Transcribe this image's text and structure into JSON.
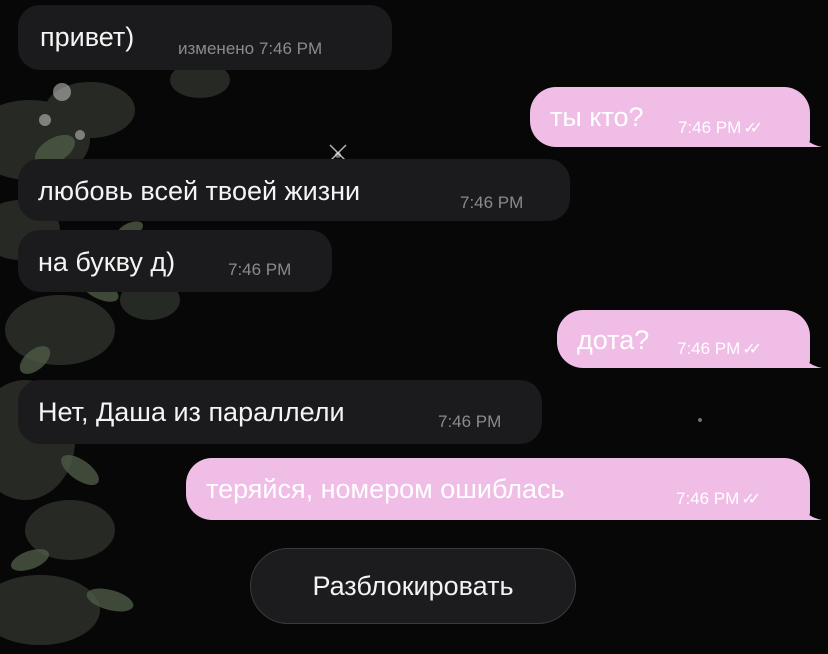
{
  "messages": [
    {
      "direction": "in",
      "text": "привет)",
      "status": "изменено",
      "time": "7:46 PM"
    },
    {
      "direction": "out",
      "text": "ты кто?",
      "time": "7:46 PM",
      "read": true
    },
    {
      "direction": "in",
      "text": "любовь всей твоей жизни",
      "time": "7:46 PM"
    },
    {
      "direction": "in",
      "text": "на букву д)",
      "time": "7:46 PM"
    },
    {
      "direction": "out",
      "text": "дота?",
      "time": "7:46 PM",
      "read": true
    },
    {
      "direction": "in",
      "text": "Нет, Даша из параллели",
      "time": "7:46 PM"
    },
    {
      "direction": "out",
      "text": "теряйся, номером ошиблась",
      "time": "7:46 PM",
      "read": true
    }
  ],
  "unblock_button": {
    "label": "Разблокировать"
  },
  "icons": {
    "read_receipt": "double-check-icon"
  },
  "colors": {
    "background": "#070707",
    "incoming_bubble": "#1b1b1d",
    "outgoing_bubble": "#efbde6",
    "button": "#1c1c1e"
  }
}
